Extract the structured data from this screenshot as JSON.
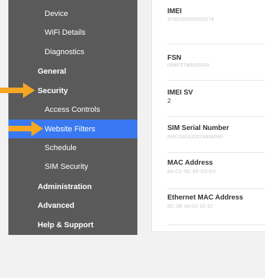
{
  "sidebar": {
    "items": [
      {
        "label": "Device",
        "level": "sub",
        "active": false
      },
      {
        "label": "WiFi Details",
        "level": "sub",
        "active": false
      },
      {
        "label": "Diagnostics",
        "level": "sub",
        "active": false
      },
      {
        "label": "General",
        "level": "top",
        "active": false
      },
      {
        "label": "Security",
        "level": "top",
        "active": false
      },
      {
        "label": "Access Controls",
        "level": "sub",
        "active": false
      },
      {
        "label": "Website Filters",
        "level": "sub",
        "active": true
      },
      {
        "label": "Schedule",
        "level": "sub",
        "active": false
      },
      {
        "label": "SIM Security",
        "level": "sub",
        "active": false
      },
      {
        "label": "Administration",
        "level": "top",
        "active": false
      },
      {
        "label": "Advanced",
        "level": "top",
        "active": false
      },
      {
        "label": "Help & Support",
        "level": "top",
        "active": false
      }
    ]
  },
  "details": {
    "rows": [
      {
        "label": "IMEI",
        "value": "3780290000004274"
      },
      {
        "label": "FSN",
        "value": "0R8F27WN0000A"
      },
      {
        "label": "IMEI SV",
        "value": "2"
      },
      {
        "label": "SIM Serial Number",
        "value": "8901290332024968095"
      },
      {
        "label": "MAC Address",
        "value": "80-CC-9C-8F-C6-E0"
      },
      {
        "label": "Ethernet MAC Address",
        "value": "8C-3B-A0-01-02-07"
      }
    ]
  },
  "colors": {
    "sidebar_bg": "#5a5a5a",
    "active_bg": "#3a78f2",
    "arrow": "#f5a623"
  },
  "annotations": {
    "arrow_icon": "arrow-right-icon"
  }
}
